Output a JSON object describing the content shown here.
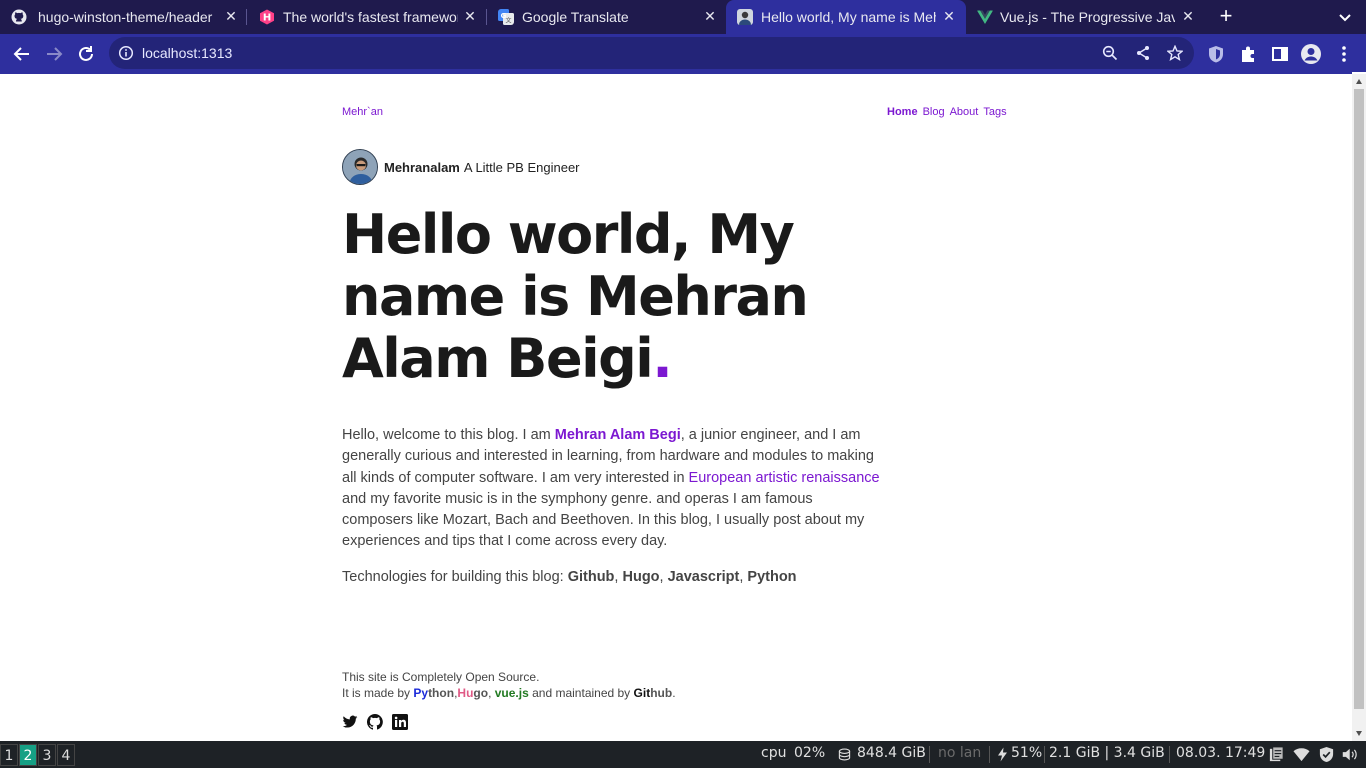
{
  "browser": {
    "tabs": [
      {
        "title": "hugo-winston-theme/header",
        "favicon": "github-icon"
      },
      {
        "title": "The world's fastest framework",
        "favicon": "hugo-icon"
      },
      {
        "title": "Google Translate",
        "favicon": "google-translate-icon"
      },
      {
        "title": "Hello world, My name is Mehran",
        "favicon": "avatar-favicon"
      },
      {
        "title": "Vue.js - The Progressive JavaScript",
        "favicon": "vue-icon"
      }
    ],
    "active_tab": 3,
    "url": "localhost:1313"
  },
  "site": {
    "brand": "Mehr`an",
    "nav": [
      "Home",
      "Blog",
      "About",
      "Tags"
    ],
    "author_name": "Mehranalam",
    "author_role": "A Little PB Engineer",
    "headline_line1": "Hello world, My",
    "headline_line2": "name is Mehran",
    "headline_line3": "Alam Beigi",
    "headline_dot": ".",
    "intro": {
      "p1": "Hello, welcome to this blog. I am ",
      "name": "Mehran Alam Begi",
      "p2": ", a junior engineer, and I am generally curious and interested in learning, from hardware and modules to making all kinds of computer software. I am very interested in ",
      "link": "European artistic renaissance",
      "p3": " and my favorite music is in the symphony genre. and operas I am famous composers like Mozart, Bach and Beethoven. In this blog, I usually post about my experiences and tips that I come across every day."
    },
    "tech": {
      "label": "Technologies for building this blog: ",
      "items": [
        "Github",
        "Hugo",
        "Javascript",
        "Python"
      ],
      "sep": ", "
    },
    "footer": {
      "line1": "This site is Completely Open Source.",
      "made_by": "It is made by ",
      "py_a": "Py",
      "py_b": "thon",
      "comma1": ",",
      "hu_a": "Hu",
      "hu_b": "go",
      "comma2": ", ",
      "vue": "vue.js",
      "maintained": " and maintained by ",
      "gi_a": "Git",
      "gi_b": "hub",
      "end": "."
    },
    "social": [
      "twitter-icon",
      "github-icon",
      "linkedin-icon"
    ],
    "accent_color": "#7c18d1"
  },
  "taskbar": {
    "workspaces": [
      "1",
      "2",
      "3",
      "4"
    ],
    "active_workspace": 1,
    "cpu_label": "cpu",
    "cpu_value": "02%",
    "disk": "848.4 GiB",
    "lan": "no lan",
    "battery": "51%",
    "memory": "2.1 GiB | 3.4 GiB",
    "datetime": "08.03. 17:49"
  }
}
